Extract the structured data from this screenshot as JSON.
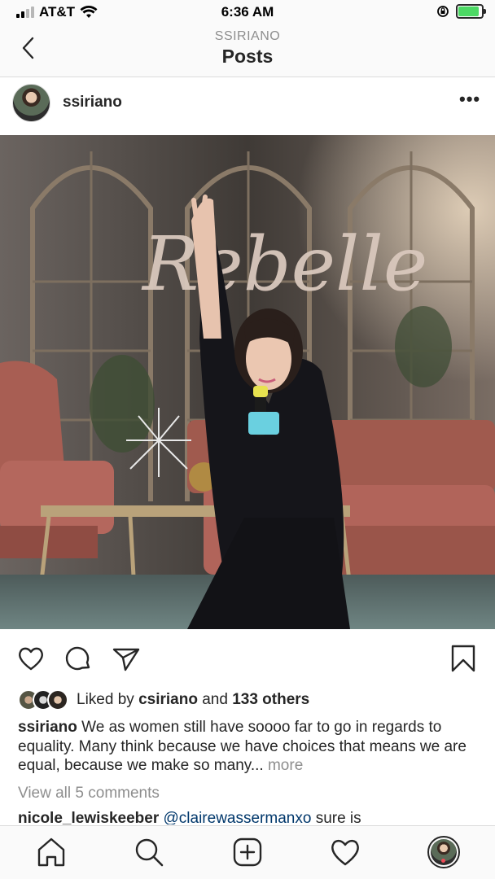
{
  "status_bar": {
    "carrier": "AT&T",
    "time": "6:36 AM",
    "battery_level": 0.9,
    "battery_color": "#4cd964"
  },
  "header": {
    "subtitle": "SSIRIANO",
    "title": "Posts",
    "back_icon": "chevron-left-icon"
  },
  "post": {
    "username": "ssiriano",
    "more_icon": "ellipsis-icon",
    "photo_sign_text": "Rebelle",
    "likes": {
      "prefix": "Liked by",
      "user": "csiriano",
      "connector": "and",
      "others": "133 others"
    },
    "caption": {
      "username": "ssiriano",
      "text": "We as women still have soooo far to go in regards to equality. Many think because we have choices that means we are equal, because we make so many...",
      "more": "more"
    },
    "view_comments": "View all 5 comments",
    "comment": {
      "username": "nicole_lewiskeeber",
      "mention": "@clairewassermanxo",
      "text": "sure is"
    }
  },
  "actions": [
    "heart-icon",
    "comment-icon",
    "share-icon",
    "bookmark-icon"
  ],
  "tabbar": [
    "home-icon",
    "search-icon",
    "add-post-icon",
    "activity-heart-icon",
    "profile-avatar"
  ],
  "colors": {
    "text": "#262626",
    "secondary": "#8e8e8e",
    "link": "#00376b",
    "notification": "#ed4956"
  }
}
